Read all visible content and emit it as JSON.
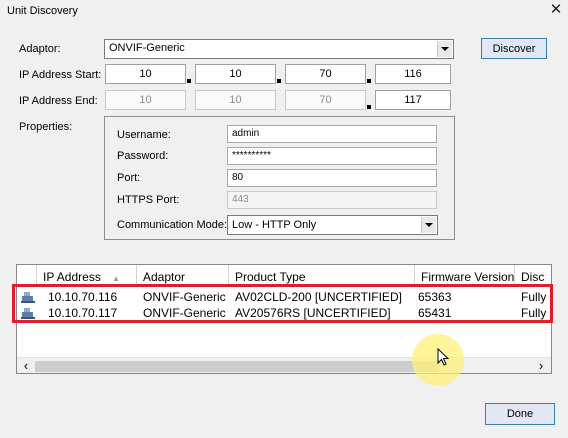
{
  "window": {
    "title": "Unit Discovery",
    "close_glyph": "✕"
  },
  "form": {
    "adaptor_label": "Adaptor:",
    "adaptor_value": "ONVIF-Generic",
    "ip_start_label": "IP Address Start:",
    "ip_start": [
      "10",
      "10",
      "70",
      "116"
    ],
    "ip_end_label": "IP Address End:",
    "ip_end": [
      "10",
      "10",
      "70",
      "117"
    ],
    "properties_label": "Properties:",
    "discover_label": "Discover"
  },
  "properties": {
    "username_label": "Username:",
    "username_value": "admin",
    "password_label": "Password:",
    "password_value": "**********",
    "port_label": "Port:",
    "port_value": "80",
    "https_port_label": "HTTPS Port:",
    "https_port_value": "443",
    "comm_mode_label": "Communication Mode:",
    "comm_mode_value": "Low - HTTP Only"
  },
  "results": {
    "columns": [
      "IP Address",
      "Adaptor",
      "Product Type",
      "Firmware Version",
      "Disc"
    ],
    "rows": [
      {
        "ip": "10.10.70.116",
        "adaptor": "ONVIF-Generic",
        "product": "AV02CLD-200 [UNCERTIFIED]",
        "firmware": "65363",
        "disc": "Fully"
      },
      {
        "ip": "10.10.70.117",
        "adaptor": "ONVIF-Generic",
        "product": "AV20576RS [UNCERTIFIED]",
        "firmware": "65431",
        "disc": "Fully"
      }
    ],
    "scroll_left": "‹",
    "scroll_right": "›"
  },
  "footer": {
    "done_label": "Done"
  },
  "colors": {
    "highlight_box": "#e01e26",
    "button_border": "#3c7fb1",
    "cursor_halo": "#fff078"
  }
}
